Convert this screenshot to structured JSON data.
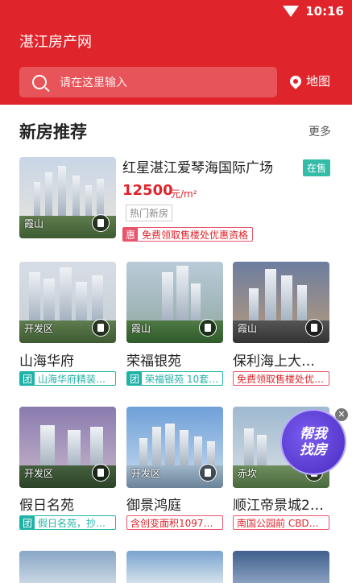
{
  "status_bar": {
    "time": "10:16"
  },
  "header": {
    "title": "湛江房产网",
    "search_placeholder": "请在这里输入",
    "map_label": "地图"
  },
  "section": {
    "title": "新房推荐",
    "more": "更多"
  },
  "featured": {
    "name": "红星湛江爱琴海国际广场",
    "status": "在售",
    "price": "12500",
    "unit": "元/m²",
    "tag": "热门新房",
    "promo_badge": "惠",
    "promo_text": "免费领取售楼处优惠资格",
    "area": "霞山"
  },
  "cards": [
    {
      "name": "山海华府",
      "area": "开发区",
      "tag_badge": "团",
      "tag_text": "山海华府精装…",
      "tag_style": "teal"
    },
    {
      "name": "荣福银苑",
      "area": "霞山",
      "tag_badge": "团",
      "tag_text": "荣福银苑 10套…",
      "tag_style": "teal"
    },
    {
      "name": "保利海上大…",
      "area": "霞山",
      "tag_badge": "",
      "tag_text": "免费领取售楼处优…",
      "tag_style": "red"
    },
    {
      "name": "假日名苑",
      "area": "开发区",
      "tag_badge": "团",
      "tag_text": "假日名苑，抄…",
      "tag_style": "teal"
    },
    {
      "name": "御景鸿庭",
      "area": "开发区",
      "tag_badge": "",
      "tag_text": "含创变面积10975…",
      "tag_style": "red"
    },
    {
      "name": "顺江帝景城2…",
      "area": "赤坎",
      "tag_badge": "",
      "tag_text": "南国公园前 CBD商…",
      "tag_style": "red"
    }
  ],
  "helper": {
    "line1": "帮我",
    "line2": "找房"
  },
  "colors": {
    "brand": "#e0242b",
    "teal": "#1fb3a8",
    "status_badge": "#33bda8"
  }
}
